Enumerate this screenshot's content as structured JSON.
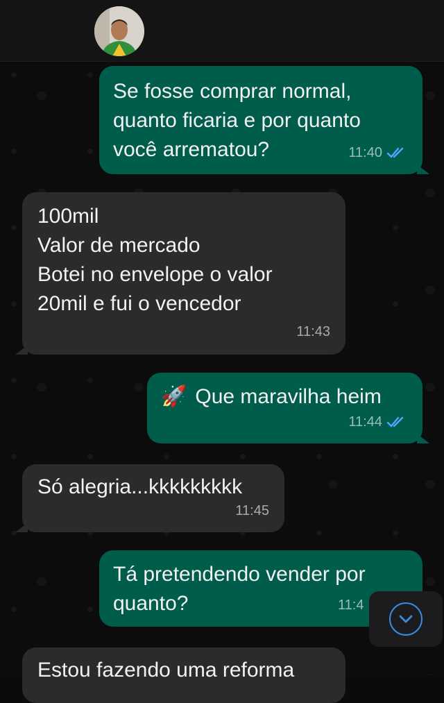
{
  "contact": {
    "avatar_icon": "profile-photo"
  },
  "colors": {
    "outgoing": "#005c4b",
    "incoming": "#2b2b2d",
    "read_ticks": "#53a6ff"
  },
  "messages": [
    {
      "direction": "out",
      "text": "Se fosse comprar normal,\nquanto ficaria e por quanto\nvocê arrematou?",
      "time": "11:40",
      "status": "read"
    },
    {
      "direction": "in",
      "text": "100mil\nValor de mercado\nBotei no envelope o valor\n20mil e fui o vencedor",
      "time": "11:43"
    },
    {
      "direction": "out",
      "emoji": "🚀",
      "text": "Que maravilha heim",
      "time": "11:44",
      "status": "read"
    },
    {
      "direction": "in",
      "text": "Só alegria...kkkkkkkkk",
      "time": "11:45"
    },
    {
      "direction": "out",
      "text": "Tá pretendendo vender por\nquanto?",
      "time": "11:4"
    },
    {
      "direction": "in",
      "text": "Estou fazendo uma reforma"
    }
  ],
  "scroll_button": {
    "icon": "chevron-down-icon"
  }
}
